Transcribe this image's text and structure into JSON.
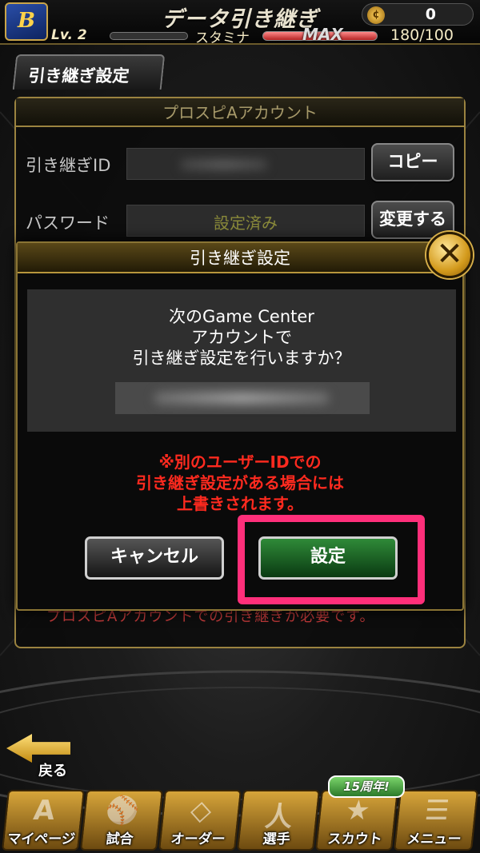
{
  "header": {
    "logo_text": "B",
    "title": "データ引き継ぎ",
    "coin_count": "0",
    "level": "Lv. 2",
    "stamina_label": "スタミナ",
    "stamina_max_label": "MAX",
    "stamina_value": "180/100"
  },
  "section_tab": "引き継ぎ設定",
  "account_panel": {
    "title": "プロスピAアカウント",
    "transfer_id_label": "引き継ぎID",
    "copy_button": "コピー",
    "password_label": "パスワード",
    "password_value": "設定済み",
    "change_button": "変更する",
    "footer_note": "プロスピAアカウントでの引き継ぎが必要です。"
  },
  "modal": {
    "title": "引き継ぎ設定",
    "message_lines": [
      "次のGame Center",
      "アカウントで",
      "引き継ぎ設定を行いますか？"
    ],
    "warning_lines": [
      "※別のユーザーIDでの",
      "引き継ぎ設定がある場合には",
      "上書きされます。"
    ],
    "cancel_button": "キャンセル",
    "confirm_button": "設定"
  },
  "back_button": "戻る",
  "bottom_nav": {
    "items": [
      {
        "label": "マイページ",
        "glyph": "A"
      },
      {
        "label": "試合",
        "glyph": "⚾"
      },
      {
        "label": "オーダー",
        "glyph": "◇"
      },
      {
        "label": "選手",
        "glyph": "人"
      },
      {
        "label": "スカウト",
        "glyph": "★"
      },
      {
        "label": "メニュー",
        "glyph": "☰"
      }
    ],
    "badge": "15周年!"
  },
  "colors": {
    "accent_gold": "#9b8340",
    "warning_red": "#ff2a1f",
    "highlight_pink": "#ff2f7a",
    "confirm_green": "#2f8a38"
  }
}
